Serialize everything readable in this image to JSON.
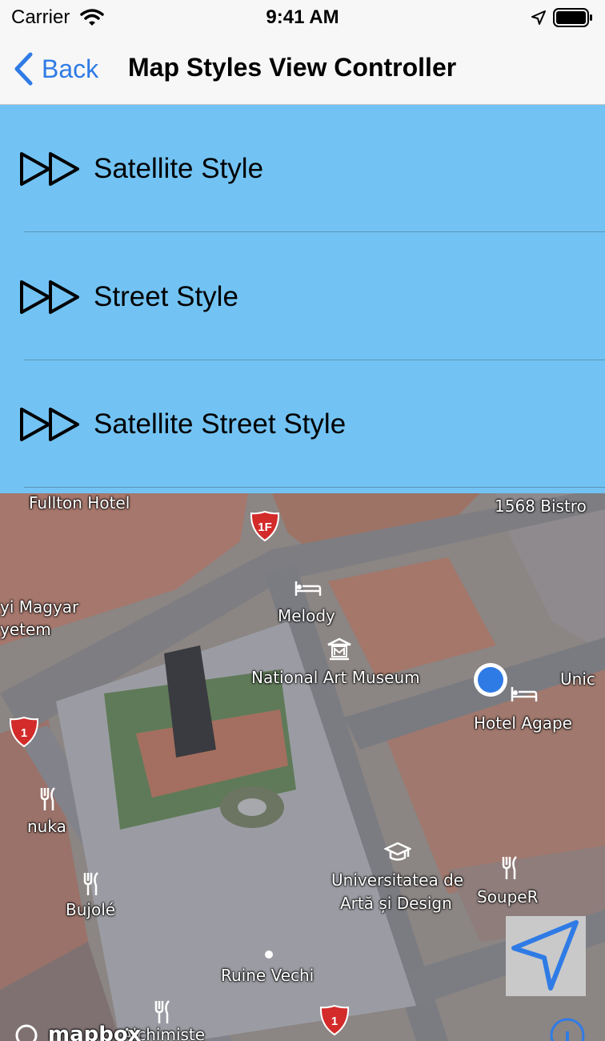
{
  "status_bar": {
    "carrier": "Carrier",
    "time": "9:41 AM"
  },
  "nav": {
    "back_label": "Back",
    "title": "Map Styles View Controller"
  },
  "styles": [
    {
      "label": "Satellite Style",
      "icon": "fast-forward-icon"
    },
    {
      "label": "Street Style",
      "icon": "fast-forward-icon"
    },
    {
      "label": "Satellite Street Style",
      "icon": "fast-forward-icon"
    }
  ],
  "colors": {
    "list_background": "#72c3f3",
    "tint": "#2f7be6",
    "user_location": "#2f7be6"
  },
  "map": {
    "labels": {
      "fullton_hotel": "Fullton Hotel",
      "bistro": "1568 Bistro",
      "magyar": "yi Magyar",
      "yetem": "yetem",
      "melody": "Melody",
      "national_art_museum": "National Art Museum",
      "unic": "Unic",
      "hotel_agape": "Hotel Agape",
      "nuka": "nuka",
      "bujole": "Bujolé",
      "universitatea_line1": "Universitatea de",
      "universitatea_line2": "Artă și Design",
      "souper": "SoupeR",
      "ruine_vechi": "Ruine Vechi",
      "alchimiste": "Alchimiste"
    },
    "shields": {
      "top": "1F",
      "left": "1",
      "bottom": "1"
    },
    "attribution": "mapbox"
  }
}
